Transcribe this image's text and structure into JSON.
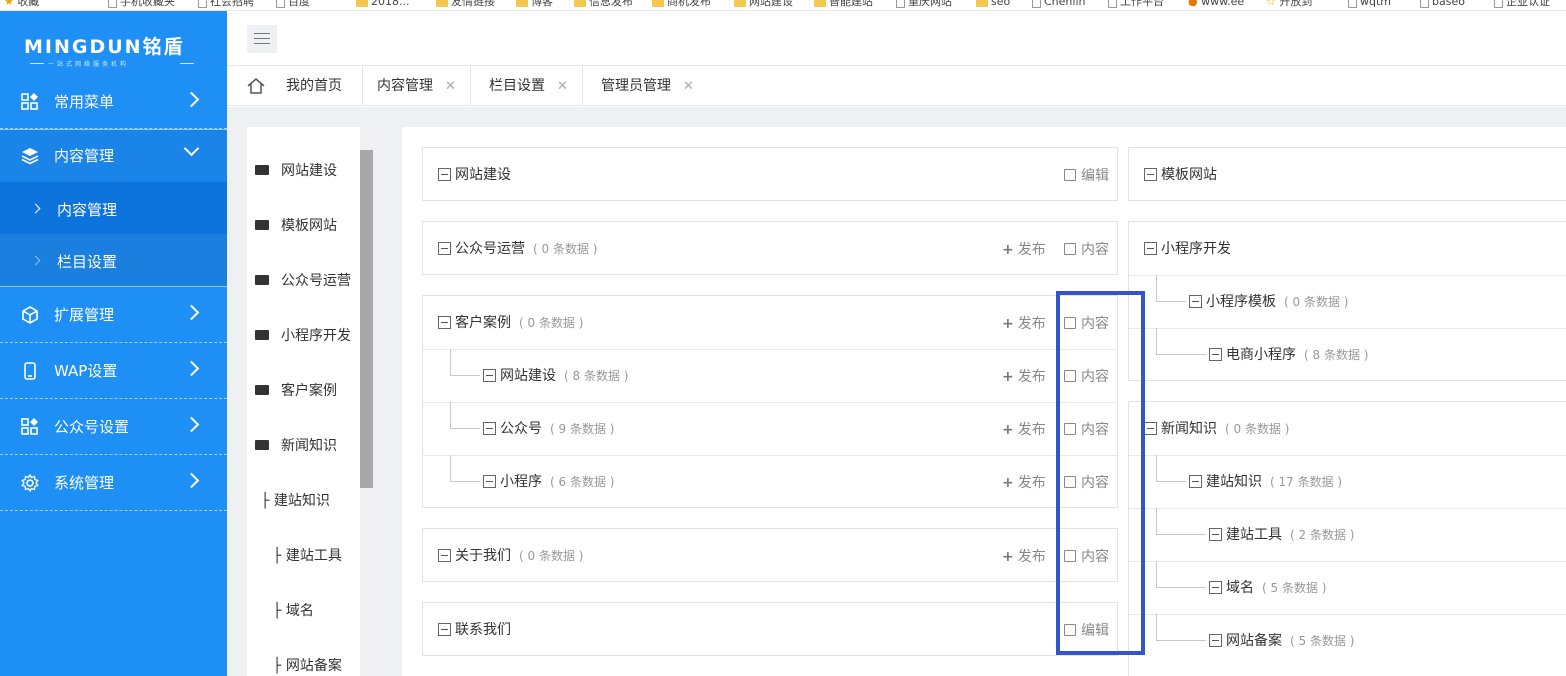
{
  "bookmarks": [
    {
      "label": "收藏"
    },
    {
      "label": "手机收藏夹"
    },
    {
      "label": "社会招聘"
    },
    {
      "label": "百度"
    },
    {
      "label": "2018... "
    },
    {
      "label": "友情链接"
    },
    {
      "label": "博客"
    },
    {
      "label": "信息发布"
    },
    {
      "label": "商机发布"
    },
    {
      "label": "网站建设"
    },
    {
      "label": "智能建站"
    },
    {
      "label": "重庆网站"
    },
    {
      "label": "seo"
    },
    {
      "label": "Chenlin"
    },
    {
      "label": "工作平台"
    },
    {
      "label": "www.ee"
    },
    {
      "label": "开放到"
    },
    {
      "label": "wqtm"
    },
    {
      "label": "baseo"
    },
    {
      "label": "企业认证"
    }
  ],
  "logo": {
    "brand": "MINGDUN铭盾",
    "slogan": "一站式网络服务机构"
  },
  "sidebar": {
    "items": [
      {
        "label": "常用菜单"
      },
      {
        "label": "内容管理"
      },
      {
        "label": "扩展管理"
      },
      {
        "label": "WAP设置"
      },
      {
        "label": "公众号设置"
      },
      {
        "label": "系统管理"
      }
    ],
    "sub": [
      {
        "label": "内容管理"
      },
      {
        "label": "栏目设置"
      }
    ]
  },
  "tabs": [
    {
      "label": "我的首页"
    },
    {
      "label": "内容管理"
    },
    {
      "label": "栏目设置"
    },
    {
      "label": "管理员管理"
    }
  ],
  "categories": [
    {
      "label": "网站建设"
    },
    {
      "label": "模板网站"
    },
    {
      "label": "公众号运营"
    },
    {
      "label": "小程序开发"
    },
    {
      "label": "客户案例"
    },
    {
      "label": "新闻知识"
    },
    {
      "label": "├ 建站知识"
    },
    {
      "label": "├ 建站工具"
    },
    {
      "label": "├ 域名"
    },
    {
      "label": "├ 网站备案"
    }
  ],
  "actions": {
    "publish": "发布",
    "content": "内容",
    "edit": "编辑"
  },
  "left_panels": [
    {
      "title": "网站建设"
    },
    {
      "title": "公众号运营",
      "count": "( 0 条数据 )"
    },
    {
      "title": "客户案例",
      "count": "( 0 条数据 )",
      "children": [
        {
          "title": "网站建设",
          "count": "( 8 条数据 )"
        },
        {
          "title": "公众号",
          "count": "( 9 条数据 )"
        },
        {
          "title": "小程序",
          "count": "( 6 条数据 )"
        }
      ]
    },
    {
      "title": "关于我们",
      "count": "( 0 条数据 )"
    },
    {
      "title": "联系我们"
    }
  ],
  "right_panels": [
    {
      "title": "模板网站"
    },
    {
      "title": "小程序开发",
      "children": [
        {
          "title": "小程序模板",
          "count": "( 0 条数据 )"
        },
        {
          "title": "电商小程序",
          "count": "( 8 条数据 )"
        }
      ]
    },
    {
      "title": "新闻知识",
      "count": "( 0 条数据 )",
      "children": [
        {
          "title": "建站知识",
          "count": "( 17 条数据 )"
        },
        {
          "title": "建站工具",
          "count": "( 2 条数据 )"
        },
        {
          "title": "域名",
          "count": "( 5 条数据 )"
        },
        {
          "title": "网站备案",
          "count": "( 5 条数据 )"
        }
      ]
    }
  ],
  "colors": {
    "sidebar": "#1e8ff5",
    "highlight": "#3355cc"
  }
}
